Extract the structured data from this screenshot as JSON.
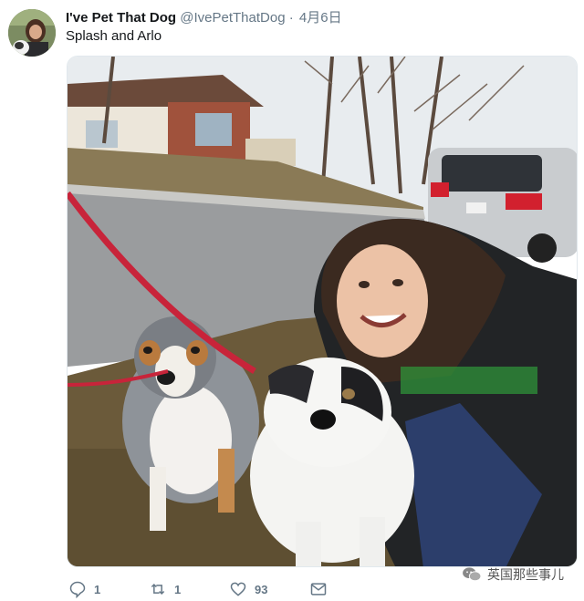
{
  "tweet": {
    "display_name": "I've Pet That Dog",
    "handle": "@IvePetThatDog",
    "separator": "·",
    "date": "4月6日",
    "text": "Splash and Arlo"
  },
  "actions": {
    "reply_count": "1",
    "retweet_count": "1",
    "like_count": "93"
  },
  "watermark": {
    "text": "英国那些事儿"
  },
  "icons": [
    "reply-icon",
    "retweet-icon",
    "heart-icon",
    "dm-icon",
    "wechat-icon"
  ],
  "colors": {
    "secondary_text": "#657786",
    "leash": "#c8243a",
    "grass": "#6b5a3a"
  }
}
